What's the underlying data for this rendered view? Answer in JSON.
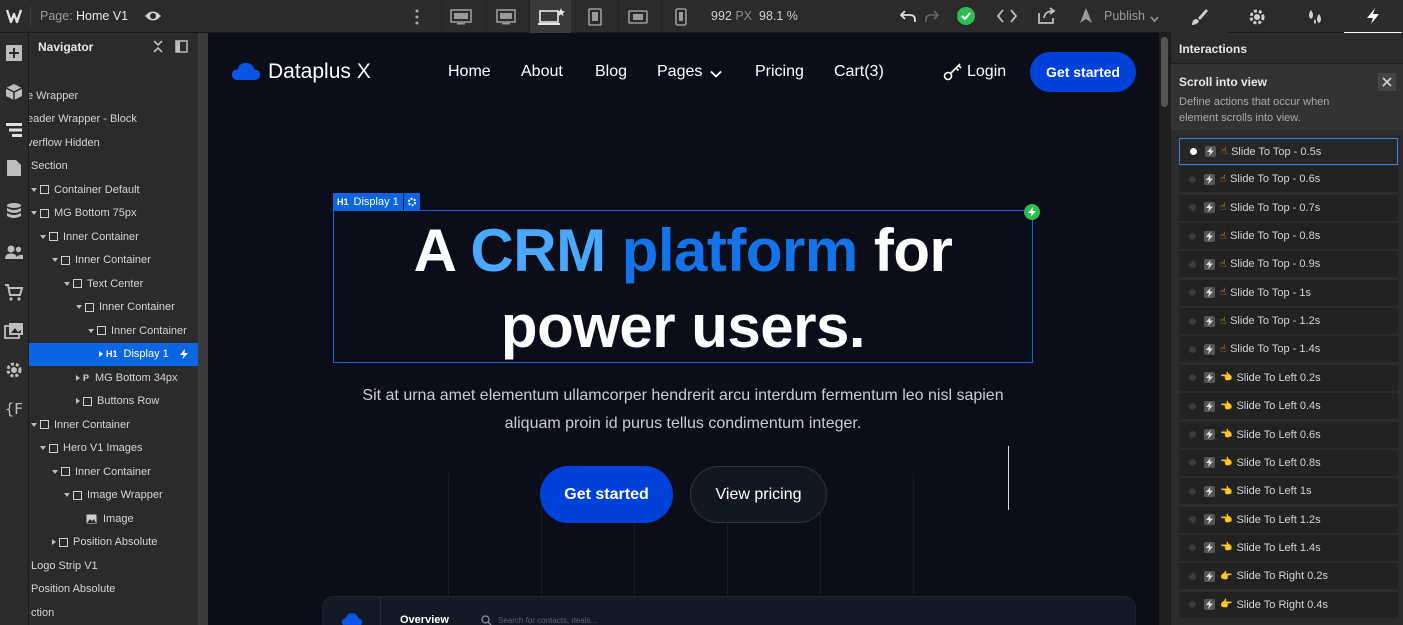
{
  "topbar": {
    "page_label": "Page:",
    "page_name": "Home V1",
    "width_value": "992",
    "width_unit": "PX",
    "zoom": "98.1 %",
    "publish_label": "Publish"
  },
  "navigator": {
    "title": "Navigator",
    "items": [
      {
        "label": "e Wrapper"
      },
      {
        "label": "eader Wrapper - Block"
      },
      {
        "label": "verflow Hidden"
      },
      {
        "label": "Section"
      },
      {
        "label": "Container Default"
      },
      {
        "label": "MG Bottom 75px"
      },
      {
        "label": "Inner Container"
      },
      {
        "label": "Inner Container"
      },
      {
        "label": "Text Center"
      },
      {
        "label": "Inner Container"
      },
      {
        "label": "Inner Container"
      },
      {
        "label": "Display 1",
        "tag": "H1"
      },
      {
        "label": "MG Bottom 34px",
        "tag": "P"
      },
      {
        "label": "Buttons Row"
      },
      {
        "label": "Inner Container"
      },
      {
        "label": "Hero V1 Images"
      },
      {
        "label": "Inner Container"
      },
      {
        "label": "Image Wrapper"
      },
      {
        "label": "Image"
      },
      {
        "label": "Position Absolute"
      },
      {
        "label": "Logo Strip V1"
      },
      {
        "label": "Position Absolute"
      },
      {
        "label": "ction"
      }
    ]
  },
  "site": {
    "brand": "Dataplus X",
    "nav": [
      "Home",
      "About",
      "Blog",
      "Pages",
      "Pricing",
      "Cart(3)"
    ],
    "login": "Login",
    "header_cta": "Get started",
    "element_tag": "H1",
    "element_name": "Display 1",
    "headline": {
      "part1": "A ",
      "part2": "CRM",
      "part3": "platform",
      "part4": " for",
      "line2": "power users."
    },
    "subtext_line1": "Sit at urna amet elementum ullamcorper hendrerit arcu interdum fermentum leo nisl sapien",
    "subtext_line2": "aliquam proin id purus tellus condimentum integer.",
    "primary_btn": "Get started",
    "secondary_btn": "View pricing",
    "dashboard_tab": "Overview",
    "dashboard_search": "Search for contacts, deals..."
  },
  "interactions": {
    "title": "Interactions",
    "trigger": "Scroll into view",
    "desc_line1": "Define actions that occur when",
    "desc_line2": "element scrolls into view.",
    "items": [
      {
        "label": "Slide To Top - 0.5s"
      },
      {
        "label": "Slide To Top - 0.6s"
      },
      {
        "label": "Slide To Top - 0.7s"
      },
      {
        "label": "Slide To Top - 0.8s"
      },
      {
        "label": "Slide To Top - 0.9s"
      },
      {
        "label": "Slide To Top - 1s"
      },
      {
        "label": "Slide To Top - 1.2s"
      },
      {
        "label": "Slide To Top - 1.4s"
      },
      {
        "label": "Slide To Left 0.2s"
      },
      {
        "label": "Slide To Left 0.4s"
      },
      {
        "label": "Slide To Left 0.6s"
      },
      {
        "label": "Slide To Left 0.8s"
      },
      {
        "label": "Slide To Left 1s"
      },
      {
        "label": "Slide To Left 1.2s"
      },
      {
        "label": "Slide To Left 1.4s"
      },
      {
        "label": "Slide To Right 0.2s"
      },
      {
        "label": "Slide To Right 0.4s"
      }
    ]
  },
  "colors": {
    "accent": "#0c66e4",
    "brand_blue": "#0042d9",
    "light_blue": "#4aa8ff",
    "success": "#2dbd4e"
  }
}
